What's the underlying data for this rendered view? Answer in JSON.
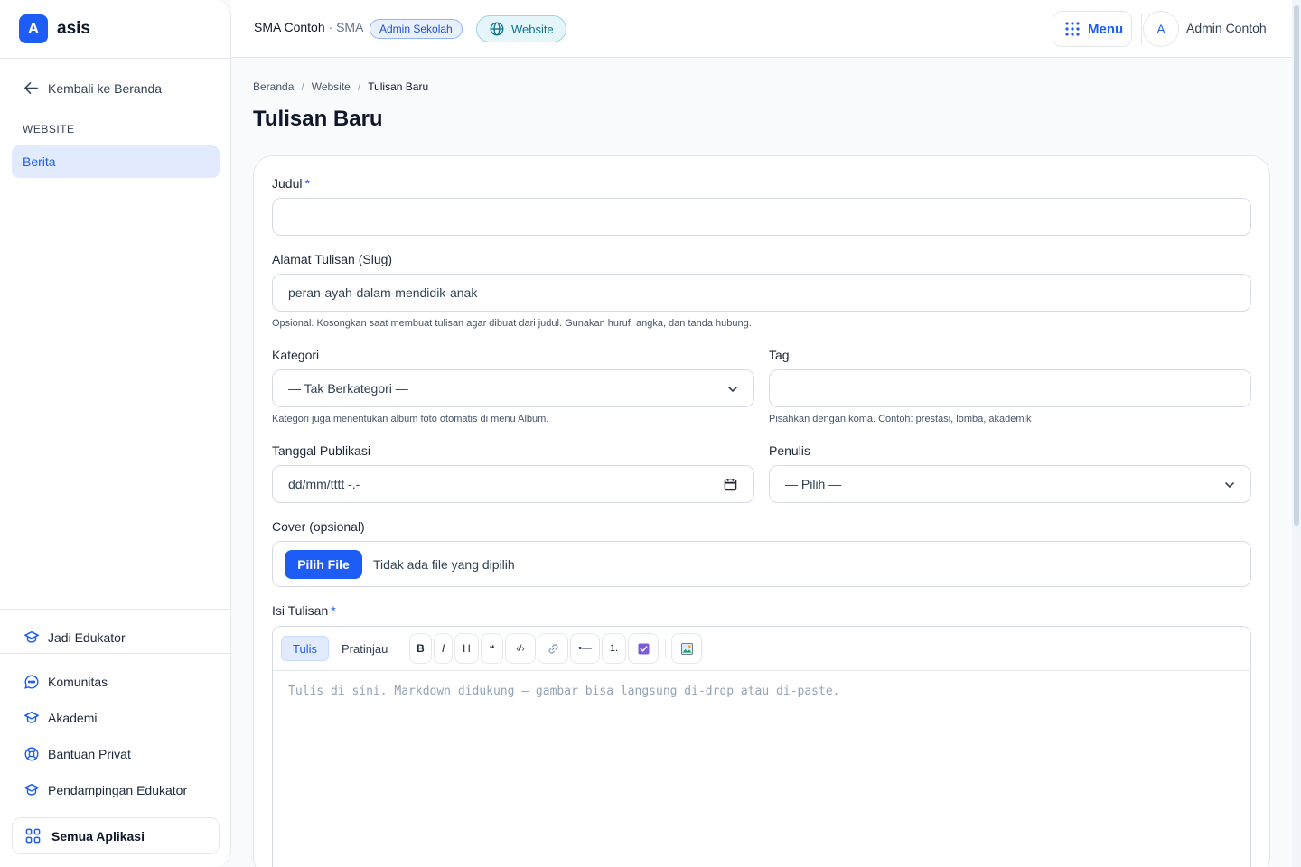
{
  "brand": {
    "badge": "A",
    "name": "asis"
  },
  "sidebar": {
    "back_label": "Kembali ke Beranda",
    "section_label": "WEBSITE",
    "active_item": "Berita",
    "items": [
      {
        "label": "Jadi Edukator",
        "icon": "graduation-cap-icon"
      },
      {
        "label": "Komunitas",
        "icon": "chat-bubble-icon"
      },
      {
        "label": "Akademi",
        "icon": "graduation-cap-icon"
      },
      {
        "label": "Bantuan Privat",
        "icon": "lifebuoy-icon"
      },
      {
        "label": "Pendampingan Edukator",
        "icon": "graduation-cap-icon"
      }
    ],
    "all_apps_label": "Semua Aplikasi"
  },
  "topbar": {
    "school_name": "SMA Contoh",
    "school_sep": " · ",
    "school_type": "SMA",
    "role_badge": "Admin Sekolah",
    "website_pill": "Website",
    "menu_label": "Menu",
    "avatar_initial": "A",
    "user_name": "Admin Contoh"
  },
  "breadcrumb": [
    "Beranda",
    "Website",
    "Tulisan Baru"
  ],
  "breadcrumb_sep": "/",
  "page_title": "Tulisan Baru",
  "form": {
    "title_label": "Judul",
    "required_mark": "*",
    "title_value": "",
    "slug_label": "Alamat Tulisan (Slug)",
    "slug_placeholder": "peran-ayah-dalam-mendidik-anak",
    "slug_hint": "Opsional. Kosongkan saat membuat tulisan agar dibuat dari judul. Gunakan huruf, angka, dan tanda hubung.",
    "category_label": "Kategori",
    "category_value": "— Tak Berkategori —",
    "category_hint": "Kategori juga menentukan album foto otomatis di menu Album.",
    "tag_label": "Tag",
    "tag_value": "",
    "tag_hint": "Pisahkan dengan koma. Contoh: prestasi, lomba, akademik",
    "date_label": "Tanggal Publikasi",
    "date_placeholder": "dd/mm/tttt  -.-",
    "author_label": "Penulis",
    "author_value": "— Pilih —",
    "cover_label": "Cover (opsional)",
    "file_button": "Pilih File",
    "file_status": "Tidak ada file yang dipilih",
    "body_label": "Isi Tulisan",
    "editor_placeholder": "Tulis di sini. Markdown didukung — gambar bisa langsung di-drop atau di-paste."
  },
  "editor_toolbar": {
    "tab_write": "Tulis",
    "tab_preview": "Pratinjau",
    "bold": "B",
    "italic": "I",
    "heading": "H",
    "quote": "❝",
    "code": "‹/›",
    "bullet": "•—",
    "numbered": "1."
  },
  "colors": {
    "accent": "#1d5cf5",
    "checkbox": "#7c5cd6"
  }
}
